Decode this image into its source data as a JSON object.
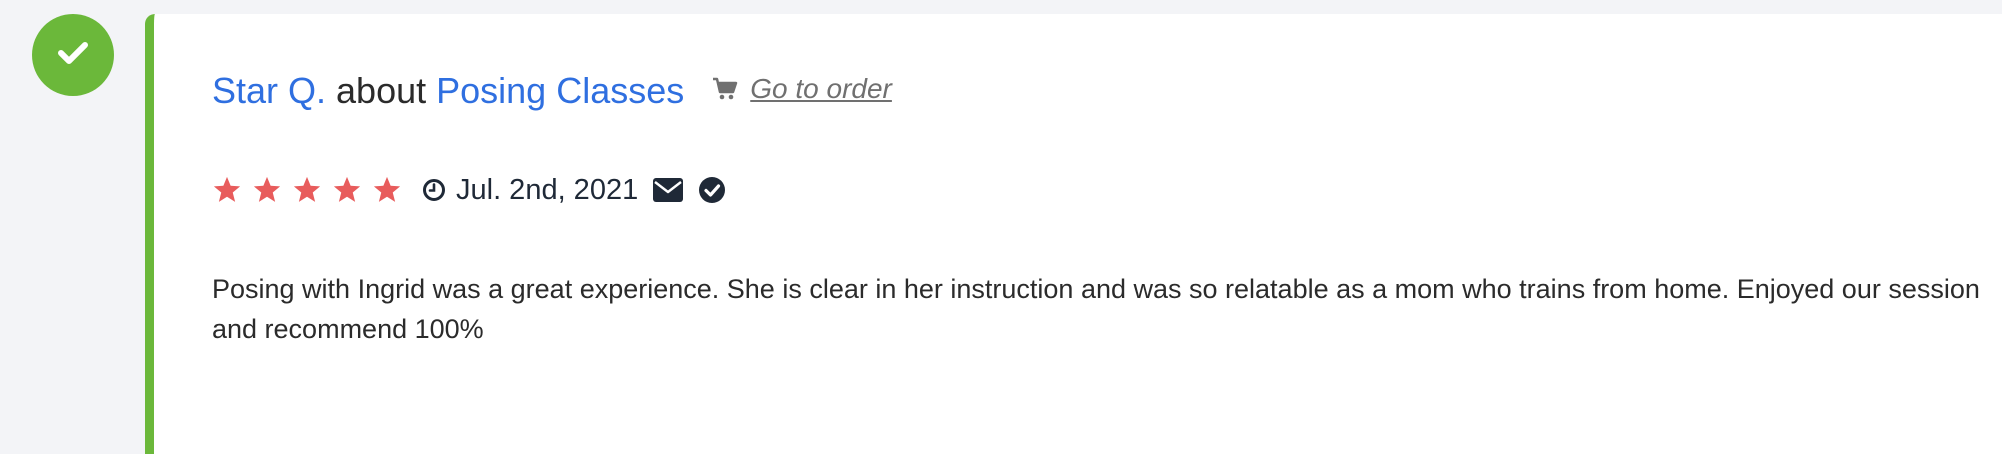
{
  "review": {
    "author": "Star Q.",
    "about": "about",
    "product": "Posing Classes",
    "go_to_order": "Go to order",
    "rating": 5,
    "rating_max": 5,
    "date": "Jul. 2nd, 2021",
    "text": "Posing with Ingrid was a great experience. She is clear in her instruction and was so relatable as a mom who trains from home. Enjoyed our session and recommend 100%"
  },
  "colors": {
    "accent_green": "#6bb83a",
    "link_blue": "#2f6fe0",
    "star_red": "#e85c5c",
    "icon_dark": "#1f2937"
  },
  "icons": {
    "status": "check-icon",
    "order": "cart-icon",
    "date": "clock-icon",
    "contact": "envelope-icon",
    "verified": "check-circle-icon"
  }
}
